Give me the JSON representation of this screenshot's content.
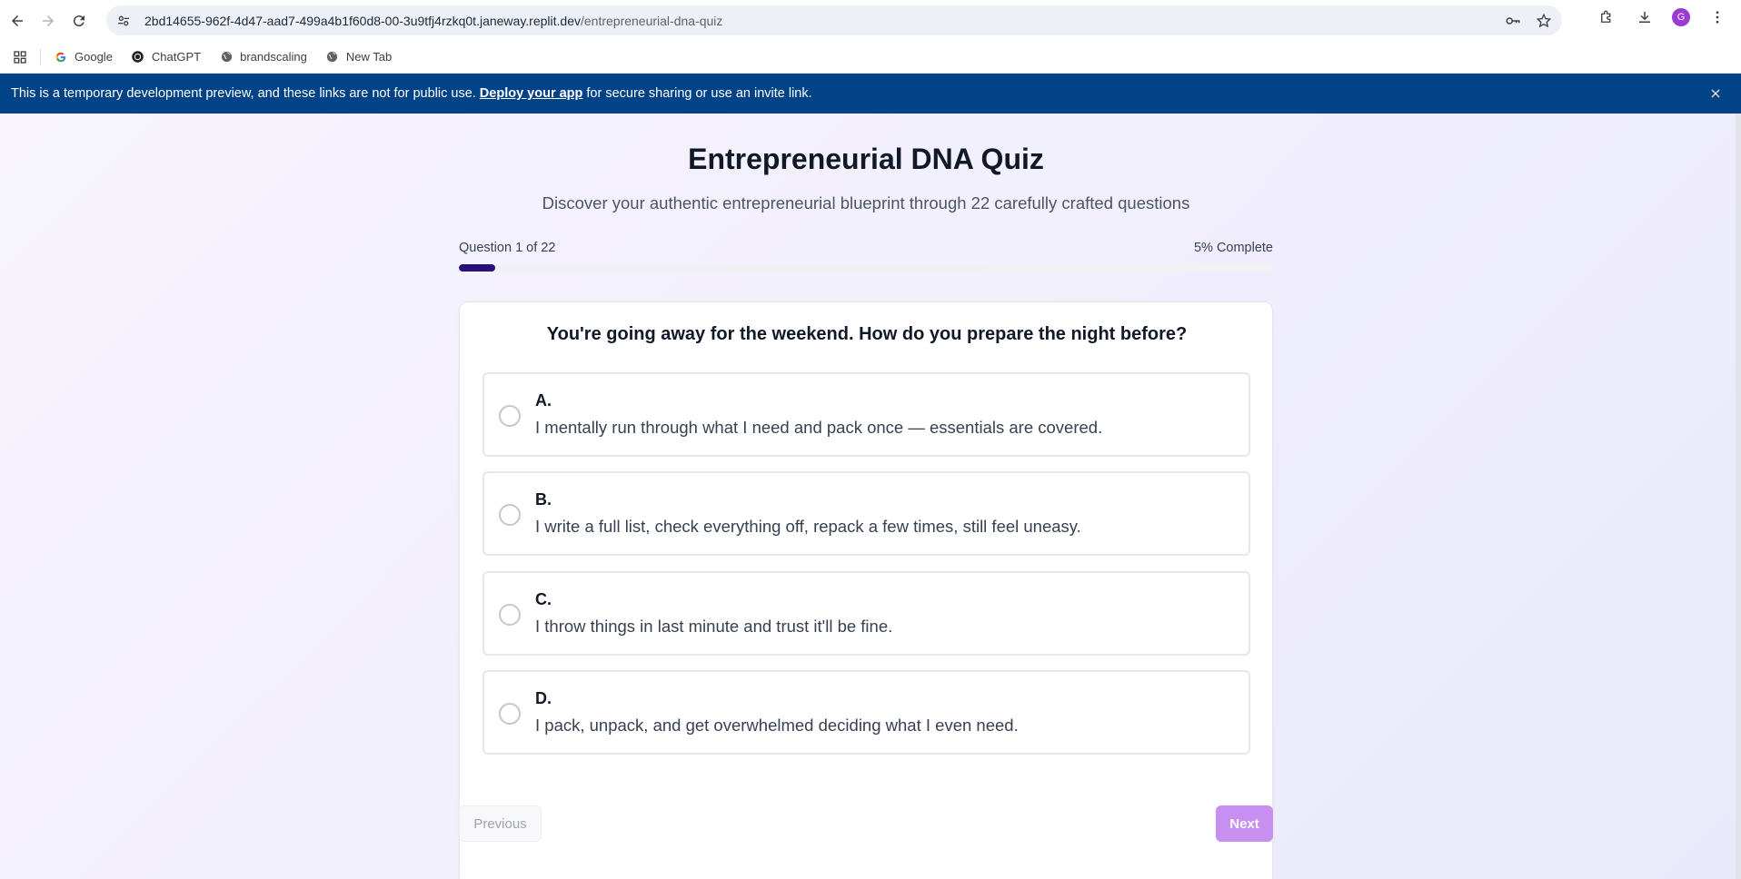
{
  "browser": {
    "url_host": "2bd14655-962f-4d47-aad7-499a4b1f60d8-00-3u9tfj4rzkq0t.janeway.replit.dev",
    "url_path": "/entrepreneurial-dna-quiz",
    "avatar_letter": "G",
    "bookmarks": [
      {
        "label": "Google",
        "icon": "google-icon"
      },
      {
        "label": "ChatGPT",
        "icon": "chatgpt-icon"
      },
      {
        "label": "brandscaling",
        "icon": "globe-icon"
      },
      {
        "label": "New Tab",
        "icon": "globe-icon"
      }
    ]
  },
  "banner": {
    "text_before": "This is a temporary development preview, and these links are not for public use.",
    "link": "Deploy your app",
    "text_after": "for secure sharing or use an invite link."
  },
  "quiz": {
    "title": "Entrepreneurial DNA Quiz",
    "subtitle": "Discover your authentic entrepreneurial blueprint through 22 carefully crafted questions",
    "progress_label": "Question 1 of 22",
    "progress_percent_label": "5% Complete",
    "progress_fraction": 0.045,
    "question": "You're going away for the weekend. How do you prepare the night before?",
    "options": [
      {
        "letter": "A.",
        "text": "I mentally run through what I need and pack once — essentials are covered."
      },
      {
        "letter": "B.",
        "text": "I write a full list, check everything off, repack a few times, still feel uneasy."
      },
      {
        "letter": "C.",
        "text": "I throw things in last minute and trust it'll be fine."
      },
      {
        "letter": "D.",
        "text": "I pack, unpack, and get overwhelmed deciding what I even need."
      }
    ],
    "previous_label": "Previous",
    "next_label": "Next"
  },
  "colors": {
    "banner": "#024387",
    "progress_fill": "#2a0f7a",
    "next_button": "#c68ff0"
  }
}
